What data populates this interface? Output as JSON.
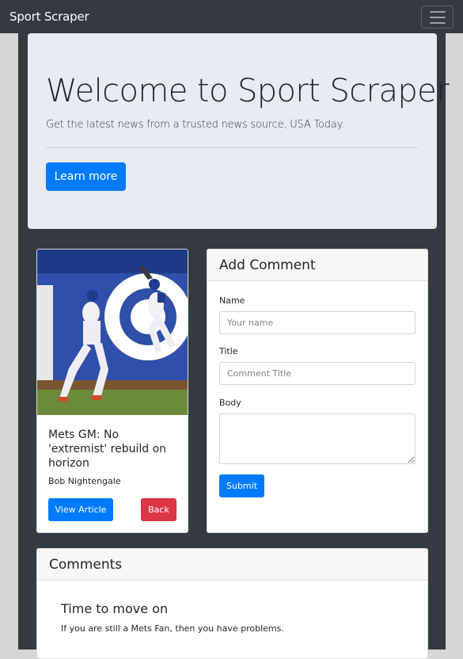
{
  "navbar": {
    "brand": "Sport Scraper",
    "menu_icon": "hamburger-menu-icon"
  },
  "jumbotron": {
    "title": "Welcome to Sport Scraper",
    "lead": "Get the latest news from a trusted news source, USA Today.",
    "button_label": "Learn more"
  },
  "article": {
    "image_icon": "baseball-player-photo",
    "title": "Mets GM: No 'extremist' rebuild on horizon",
    "author": "Bob Nightengale",
    "view_label": "View Article",
    "back_label": "Back"
  },
  "comment_form": {
    "header": "Add Comment",
    "name_label": "Name",
    "name_placeholder": "Your name",
    "title_label": "Title",
    "title_placeholder": "Comment Title",
    "body_label": "Body",
    "submit_label": "Submit"
  },
  "comments": {
    "header": "Comments",
    "items": [
      {
        "title": "Time to move on",
        "body": "If you are still a Mets Fan, then you have problems."
      }
    ]
  },
  "colors": {
    "navbar": "#343a40",
    "primary": "#007bff",
    "danger": "#dc3545",
    "jumbotron": "#e9ecef"
  }
}
